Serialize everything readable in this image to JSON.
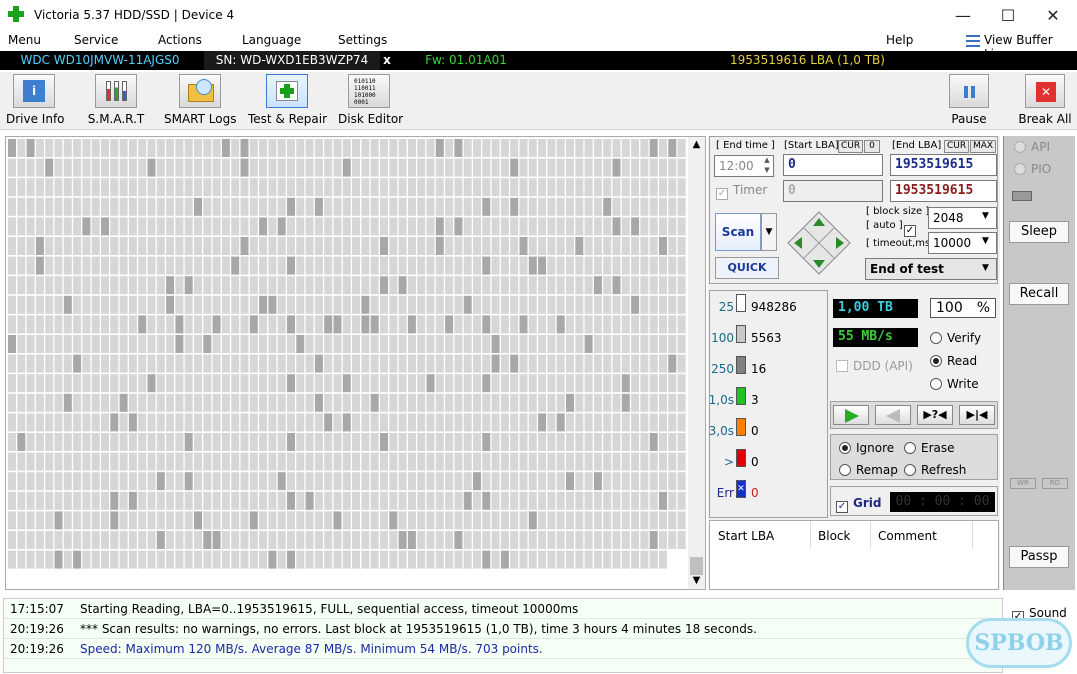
{
  "window": {
    "title": "Victoria 5.37 HDD/SSD | Device 4",
    "minimize": "—",
    "maximize": "☐",
    "close": "✕"
  },
  "menu": {
    "items": [
      "Menu",
      "Service",
      "Actions",
      "Language",
      "Settings"
    ],
    "help": "Help",
    "view_buffer": "View Buffer Live"
  },
  "drive": {
    "model": "WDC WD10JMVW-11AJGS0",
    "serial": "SN: WD-WXD1EB3WZP74",
    "close": "x",
    "firmware": "Fw: 01.01A01",
    "capacity": "1953519616 LBA (1,0 TB)"
  },
  "toolbar": {
    "drive_info": "Drive Info",
    "smart": "S.M.A.R.T",
    "smart_logs": "SMART Logs",
    "test_repair": "Test & Repair",
    "disk_editor": "Disk Editor",
    "disk_editor_icon_text": "010110\n110011\n101000\n0001",
    "pause": "Pause",
    "break_all": "Break All"
  },
  "scan": {
    "end_time_label": "[ End time ]",
    "start_lba_label": "[Start LBA]",
    "cur": "CUR",
    "start_zero": "0",
    "end_lba_label": "[End LBA]",
    "max": "MAX",
    "end_time": "12:00",
    "start_lba": "0",
    "end_lba": "1953519615",
    "timer_label": "Timer",
    "timer_value": "0",
    "end_lba2": "1953519615",
    "scan_button": "Scan",
    "quick_button": "QUICK",
    "block_size_label": "[ block size ]",
    "auto_label": "[ auto ]",
    "timeout_label": "[ timeout,ms ]",
    "block_size": "2048",
    "timeout": "10000",
    "end_of_test": "End of test"
  },
  "stats": {
    "rows": [
      {
        "label": "25",
        "count": "948286",
        "color": "#ffffff"
      },
      {
        "label": "100",
        "count": "5563",
        "color": "#c8c8c8"
      },
      {
        "label": "250",
        "count": "16",
        "color": "#808080"
      },
      {
        "label": "1,0s",
        "count": "3",
        "color": "#22c022"
      },
      {
        "label": "3,0s",
        "count": "0",
        "color": "#ff8000"
      },
      {
        "label": ">",
        "count": "0",
        "color": "#e00000"
      },
      {
        "label": "Err",
        "count": "0",
        "color": "#1030d0"
      }
    ],
    "size": "1,00 TB",
    "percent": "100",
    "percent_unit": "%",
    "speed": "55 MB/s",
    "ddd": "DDD (API)",
    "verify": "Verify",
    "read": "Read",
    "write": "Write",
    "ignore": "Ignore",
    "erase": "Erase",
    "remap": "Remap",
    "refresh": "Refresh",
    "grid": "Grid",
    "timer_display": "00 : 00 : 00"
  },
  "results": {
    "col_start": "Start LBA",
    "col_block": "Block",
    "col_comment": "Comment"
  },
  "side": {
    "api": "API",
    "pio": "PIO",
    "sleep": "Sleep",
    "recall": "Recall",
    "wr": "WR",
    "rd": "RD",
    "passp": "Passp",
    "sound": "Sound"
  },
  "log": [
    {
      "time": "17:15:07",
      "text": "Starting Reading, LBA=0..1953519615, FULL, sequential access, timeout 10000ms",
      "color": "#000000"
    },
    {
      "time": "20:19:26",
      "text": "*** Scan results: no warnings, no errors. Last block at 1953519615 (1,0 TB), time 3 hours 4 minutes 18 seconds.",
      "color": "#000000"
    },
    {
      "time": "20:19:26",
      "text": "Speed: Maximum 120 MB/s. Average 87 MB/s. Minimum 54 MB/s. 703 points.",
      "color": "#1a2aa0"
    }
  ],
  "watermark": "SPBOB"
}
